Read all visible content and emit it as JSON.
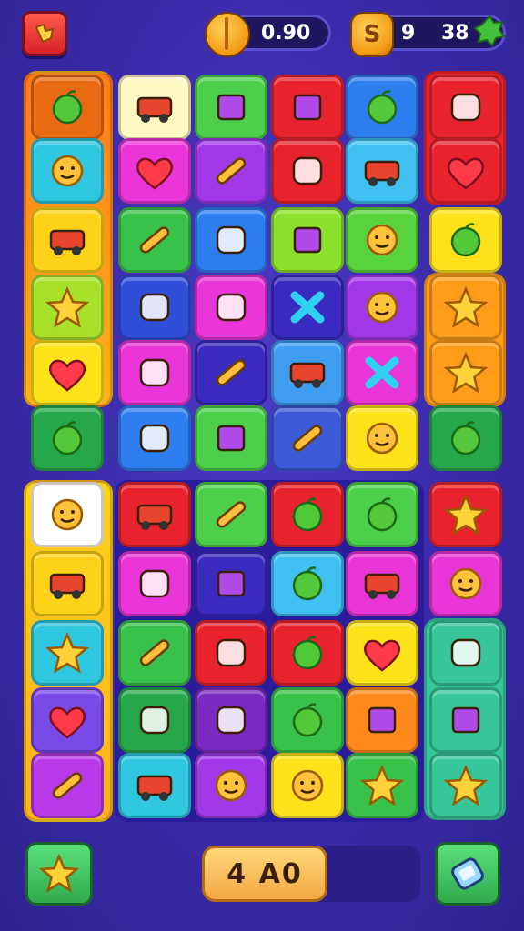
{
  "header": {
    "menu_button_icon": "puzzle-piece-icon",
    "coins_value": "0.90",
    "money_value": "9",
    "money_value_2": "38",
    "money_icon_text": "S",
    "extra_icon": "leaf-badge-icon"
  },
  "board": {
    "rows": 11,
    "cols": 6,
    "tiles": [
      {
        "icon": "globe-icon"
      },
      {
        "icon": "truck-icon"
      },
      {
        "icon": "block-icon"
      },
      {
        "icon": "box-icon"
      },
      {
        "icon": "apple-icon"
      },
      {
        "icon": "puzzle-icon"
      },
      {
        "icon": "sun-face-icon"
      },
      {
        "icon": "broken-heart-icon"
      },
      {
        "icon": "popsicle-icon"
      },
      {
        "icon": "paper-plane-icon"
      },
      {
        "icon": "van-icon"
      },
      {
        "icon": "heart-icon"
      },
      {
        "icon": "fire-truck-icon"
      },
      {
        "icon": "crayon-icon"
      },
      {
        "icon": "camera-icon"
      },
      {
        "icon": "gift-bag-icon"
      },
      {
        "icon": "smiley-icon"
      },
      {
        "icon": "spiral-icon"
      },
      {
        "icon": "star-icon"
      },
      {
        "icon": "fish-icon"
      },
      {
        "icon": "chair-icon"
      },
      {
        "icon": "x-mark-icon"
      },
      {
        "icon": "doll-face-icon"
      },
      {
        "icon": "star-icon"
      },
      {
        "icon": "heart-icon"
      },
      {
        "icon": "map-icon"
      },
      {
        "icon": "crayon-icon"
      },
      {
        "icon": "car-icon"
      },
      {
        "icon": "x-cross-icon"
      },
      {
        "icon": "star-icon"
      },
      {
        "icon": "shell-icon"
      },
      {
        "icon": "bird-icon"
      },
      {
        "icon": "jar-icon"
      },
      {
        "icon": "crayon-icon"
      },
      {
        "icon": "sun-face-icon"
      },
      {
        "icon": "flower-icon"
      },
      {
        "icon": "poodle-icon"
      },
      {
        "icon": "tractor-icon"
      },
      {
        "icon": "lipstick-icon"
      },
      {
        "icon": "pepper-icon"
      },
      {
        "icon": "apple-icon"
      },
      {
        "icon": "star-icon"
      },
      {
        "icon": "bus-icon"
      },
      {
        "icon": "camera-icon"
      },
      {
        "icon": "safe-icon"
      },
      {
        "icon": "ring-icon"
      },
      {
        "icon": "van-icon"
      },
      {
        "icon": "sun-icon"
      },
      {
        "icon": "star-icon"
      },
      {
        "icon": "bandage-icon"
      },
      {
        "icon": "cheese-icon"
      },
      {
        "icon": "ring-icon"
      },
      {
        "icon": "heart-icon"
      },
      {
        "icon": "boomerang-icon"
      },
      {
        "icon": "heart-icon"
      },
      {
        "icon": "rainbow-icon"
      },
      {
        "icon": "ladder-icon"
      },
      {
        "icon": "leaf-icon"
      },
      {
        "icon": "cube-icon"
      },
      {
        "icon": "square-icon"
      },
      {
        "icon": "feather-icon"
      },
      {
        "icon": "cart-icon"
      },
      {
        "icon": "sun-face-icon"
      },
      {
        "icon": "smiley-icon"
      },
      {
        "icon": "star-icon"
      },
      {
        "icon": "star-badge-icon"
      }
    ]
  },
  "footer": {
    "left_button_icon": "star-icon",
    "timer_text": "4 A0",
    "right_button_icon": "phone-icon"
  }
}
